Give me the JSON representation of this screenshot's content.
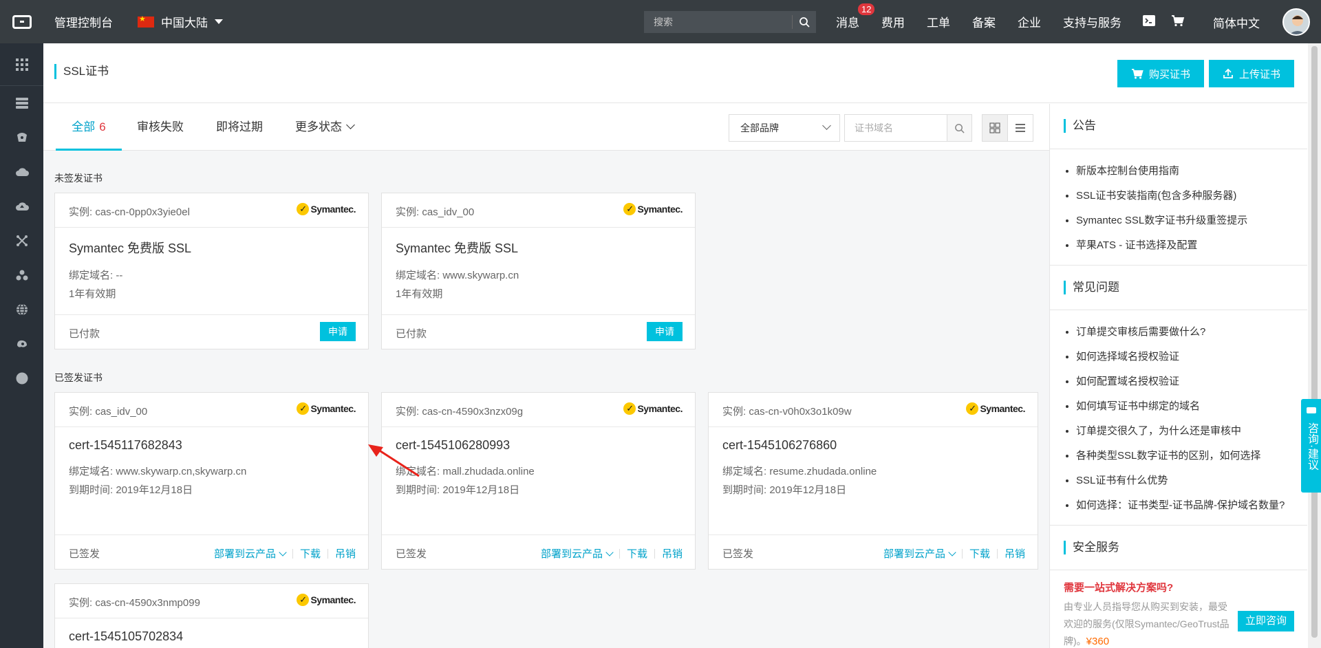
{
  "topbar": {
    "console_title": "管理控制台",
    "region": "中国大陆",
    "search_placeholder": "搜索",
    "menu": [
      {
        "label": "消息",
        "badge": "12"
      },
      {
        "label": "费用"
      },
      {
        "label": "工单"
      },
      {
        "label": "备案"
      },
      {
        "label": "企业"
      },
      {
        "label": "支持与服务"
      }
    ],
    "language": "简体中文"
  },
  "sidebar": {
    "icons": [
      "grid-icon",
      "server-icon",
      "database-icon",
      "cloud-icon",
      "cloud-upload-icon",
      "network-icon",
      "cluster-icon",
      "globe-icon",
      "settings-icon",
      "circle-icon"
    ]
  },
  "header": {
    "title": "SSL证书",
    "buy_button": "购买证书",
    "upload_button": "上传证书"
  },
  "tabs": {
    "all_label": "全部",
    "all_count": "6",
    "failed": "审核失败",
    "expiring": "即将过期",
    "more": "更多状态"
  },
  "filters": {
    "brand_select": "全部品牌",
    "domain_placeholder": "证书域名"
  },
  "sections": {
    "unissued": "未签发证书",
    "issued": "已签发证书"
  },
  "brand_name": "Symantec.",
  "unissued_cards": [
    {
      "instance": "实例: cas-cn-0pp0x3yie0el",
      "name": "Symantec 免费版 SSL",
      "domain": "绑定域名: --",
      "validity": "1年有效期",
      "status": "已付款",
      "action": "申请"
    },
    {
      "instance": "实例: cas_idv_00",
      "name": "Symantec 免费版 SSL",
      "domain": "绑定域名: www.skywarp.cn",
      "validity": "1年有效期",
      "status": "已付款",
      "action": "申请"
    }
  ],
  "issued_cards": [
    {
      "instance": "实例: cas_idv_00",
      "name": "cert-1545117682843",
      "domain": "绑定域名: www.skywarp.cn,skywarp.cn",
      "expiry": "到期时间: 2019年12月18日",
      "status": "已签发"
    },
    {
      "instance": "实例: cas-cn-4590x3nzx09g",
      "name": "cert-1545106280993",
      "domain": "绑定域名: mall.zhudada.online",
      "expiry": "到期时间: 2019年12月18日",
      "status": "已签发"
    },
    {
      "instance": "实例: cas-cn-v0h0x3o1k09w",
      "name": "cert-1545106276860",
      "domain": "绑定域名: resume.zhudada.online",
      "expiry": "到期时间: 2019年12月18日",
      "status": "已签发"
    },
    {
      "instance": "实例: cas-cn-4590x3nmp099",
      "name": "cert-1545105702834"
    }
  ],
  "card_actions": {
    "deploy": "部署到云产品",
    "download": "下载",
    "revoke": "吊销"
  },
  "right_panel": {
    "notice_title": "公告",
    "notices": [
      "新版本控制台使用指南",
      "SSL证书安装指南(包含多种服务器)",
      "Symantec SSL数字证书升级重签提示",
      "苹果ATS - 证书选择及配置"
    ],
    "faq_title": "常见问题",
    "faqs": [
      "订单提交审核后需要做什么?",
      "如何选择域名授权验证",
      "如何配置域名授权验证",
      "如何填写证书中绑定的域名",
      "订单提交很久了，为什么还是审核中",
      "各种类型SSL数字证书的区别，如何选择",
      "SSL证书有什么优势",
      "如何选择：证书类型-证书品牌-保护域名数量?"
    ],
    "security_title": "安全服务",
    "promo_title": "需要一站式解决方案吗?",
    "promo_text": "由专业人员指导您从购买到安装，最受欢迎的服务(仅限Symantec/GeoTrust品牌)。",
    "promo_price": "¥360",
    "promo_button": "立即咨询"
  },
  "float_advice": "咨询·建议",
  "colors": {
    "accent": "#00c1de",
    "topbar": "#373d41",
    "sidebar": "#293038",
    "badge": "#e0363d"
  }
}
